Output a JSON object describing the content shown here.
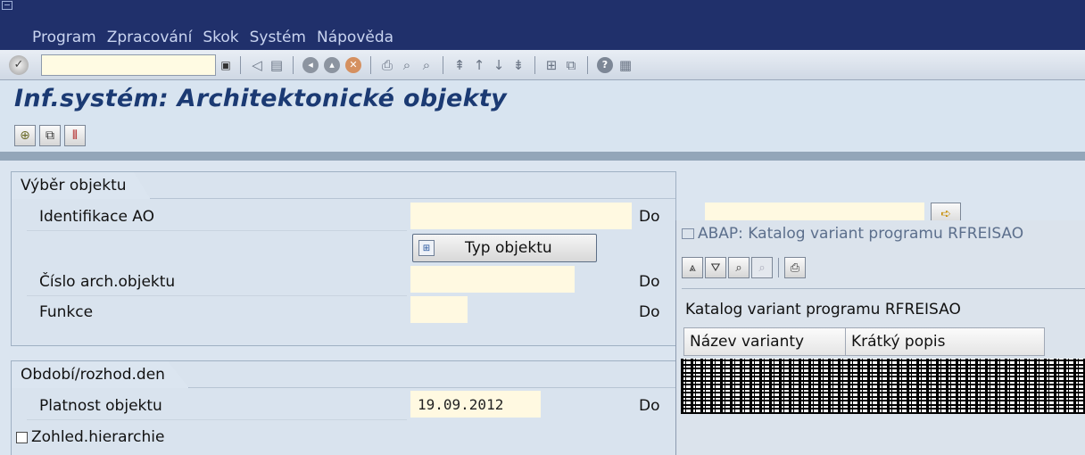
{
  "menu": [
    "Program",
    "Zpracování",
    "Skok",
    "Systém",
    "Nápověda"
  ],
  "toolbar": {
    "command_field_value": "",
    "icons": [
      "enter-icon",
      "back-icon",
      "save-icon",
      "exit-icon",
      "cancel-icon",
      "print-icon",
      "find-icon",
      "find-next-icon",
      "first-page-icon",
      "prev-page-icon",
      "next-page-icon",
      "last-page-icon",
      "new-session-icon",
      "shortcut-icon",
      "help-icon",
      "layout-icon"
    ]
  },
  "page": {
    "title": "Inf.systém: Architektonické objekty"
  },
  "app_toolbar": [
    "execute-icon",
    "get-variant-icon",
    "multiple-selection-icon"
  ],
  "section_object": {
    "tab": "Výběr objektu",
    "fields": [
      {
        "label": "Identifikace AO",
        "from": "",
        "to_label": "Do",
        "to": ""
      },
      {
        "label": "Číslo arch.objektu",
        "from": "",
        "to_label": "Do"
      },
      {
        "label": "Funkce",
        "from": "",
        "to_label": "Do"
      }
    ],
    "type_button": "Typ objektu"
  },
  "section_period": {
    "tab": "Období/rozhod.den",
    "validity_label": "Platnost objektu",
    "validity_value": "19.09.2012",
    "to_label": "Do",
    "hierarchy_label": "Zohled.hierarchie",
    "hierarchy_checked": false
  },
  "dialog": {
    "title": "ABAP: Katalog variant programu RFREISAO",
    "caption": "Katalog variant programu RFREISAO",
    "columns": [
      "Název varianty",
      "Krátký popis"
    ]
  },
  "colors": {
    "title_bar": "#20306b",
    "page_title": "#1b3a73",
    "input_bg": "#fff9e1"
  }
}
